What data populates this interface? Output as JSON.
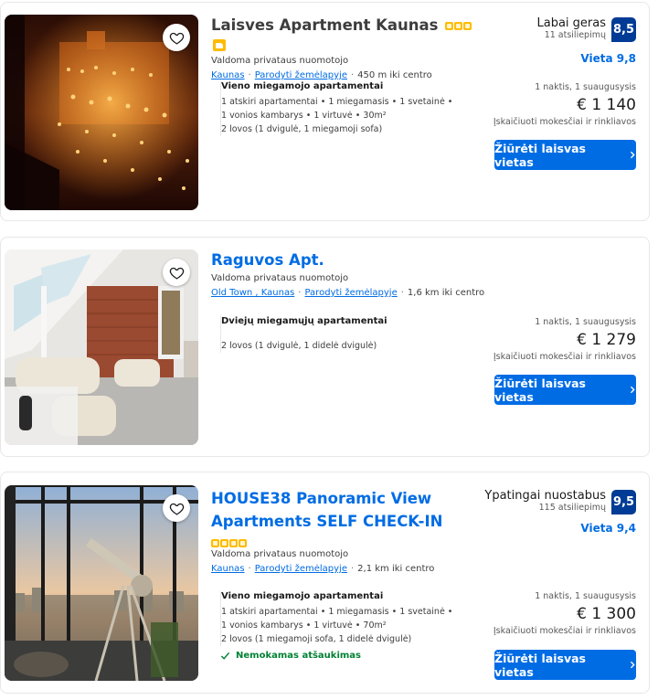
{
  "listings": [
    {
      "title": "Laisves Apartment Kaunas",
      "stars": 3,
      "managed": "Valdoma privataus nuomotojo",
      "location": "Kaunas",
      "map_link": "Parodyti žemėlapyje",
      "distance": "450 m iki centro",
      "room_name": "Vieno miegamojo apartamentai",
      "room_lines": [
        "1 atskiri apartamentai • 1 miegamasis • 1 svetainė •",
        "1 vonios kambarys • 1 virtuvė • 30m²",
        "2 lovos (1 dvigulė, 1 miegamoji sofa)"
      ],
      "rating_word": "Labai geras",
      "rating_count": "11 atsiliepimų",
      "score": "8,5",
      "location_score": "Vieta 9,8",
      "nights": "1 naktis, 1 suaugusysis",
      "price": "€ 1 140",
      "taxes": "Įskaičiuoti mokesčiai ir rinkliavos",
      "cta": "Žiūrėti laisvas vietas"
    },
    {
      "title": "Raguvos Apt.",
      "managed": "Valdoma privataus nuomotojo",
      "location": "Old Town , Kaunas",
      "map_link": "Parodyti žemėlapyje",
      "distance": "1,6 km iki centro",
      "room_name": "Dviejų miegamųjų apartamentai",
      "room_lines": [
        "2 lovos (1 dvigulė, 1 didelė dvigulė)"
      ],
      "nights": "1 naktis, 1 suaugusysis",
      "price": "€ 1 279",
      "taxes": "Įskaičiuoti mokesčiai ir rinkliavos",
      "cta": "Žiūrėti laisvas vietas"
    },
    {
      "title_line1": "HOUSE38 Panoramic View",
      "title_line2": "Apartments SELF CHECK-IN",
      "stars": 4,
      "managed": "Valdoma privataus nuomotojo",
      "location": "Kaunas",
      "map_link": "Parodyti žemėlapyje",
      "distance": "2,1 km iki centro",
      "room_name": "Vieno miegamojo apartamentai",
      "room_lines": [
        "1 atskiri apartamentai • 1 miegamasis • 1 svetainė •",
        "1 vonios kambarys • 1 virtuvė • 70m²",
        "2 lovos (1 miegamoji sofa, 1 didelė dvigulė)"
      ],
      "free_cancel": "Nemokamas atšaukimas",
      "rating_word": "Ypatingai nuostabus",
      "rating_count": "115 atsiliepimų",
      "score": "9,5",
      "location_score": "Vieta 9,4",
      "nights": "1 naktis, 1 suaugusysis",
      "price": "€ 1 300",
      "taxes": "Įskaičiuoti mokesčiai ir rinkliavos",
      "cta": "Žiūrėti laisvas vietas"
    }
  ],
  "colors": {
    "brand_blue": "#006ce4",
    "score_blue": "#003b95",
    "star_yellow": "#febb02",
    "green": "#008234"
  },
  "icons": [
    "heart-icon",
    "chevron-right-icon",
    "check-icon",
    "star-icon",
    "thumbs-up-icon"
  ]
}
